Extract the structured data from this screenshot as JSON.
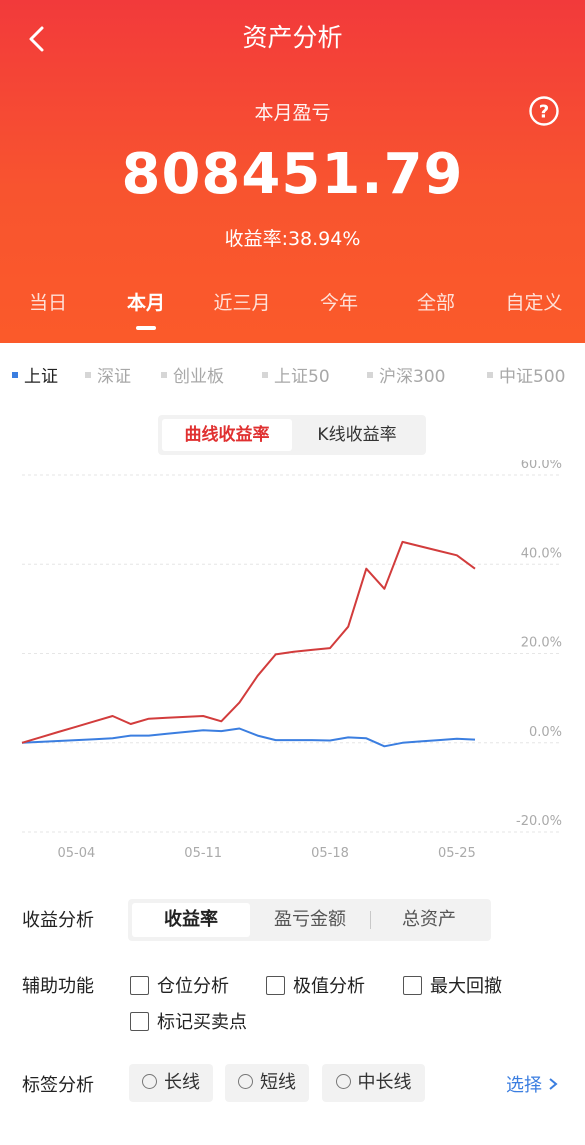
{
  "header": {
    "title": "资产分析",
    "month_label": "本月盈亏",
    "profit_value": "808451.79",
    "rate_label": "收益率:38.94%",
    "tabs": [
      "当日",
      "本月",
      "近三月",
      "今年",
      "全部",
      "自定义"
    ],
    "active_tab": "本月"
  },
  "indices": [
    "上证",
    "深证",
    "创业板",
    "上证50",
    "沪深300",
    "中证500"
  ],
  "chart_toggle": {
    "curve": "曲线收益率",
    "kline": "K线收益率"
  },
  "chart_data": {
    "type": "line",
    "x": [
      "05-01",
      "05-02",
      "05-03",
      "05-04",
      "05-05",
      "05-06",
      "05-07",
      "05-08",
      "05-09",
      "05-10",
      "05-11",
      "05-12",
      "05-13",
      "05-14",
      "05-15",
      "05-16",
      "05-17",
      "05-18",
      "05-19",
      "05-20",
      "05-21",
      "05-22",
      "05-23",
      "05-24",
      "05-25",
      "05-26"
    ],
    "x_ticks": [
      "05-04",
      "05-11",
      "05-18",
      "05-25"
    ],
    "y_ticks": [
      "60.0%",
      "40.0%",
      "20.0%",
      "0.0%",
      "-20.0%"
    ],
    "ylim": [
      -20,
      60
    ],
    "grid": true,
    "series": [
      {
        "color": "#d23c3c",
        "values": [
          0,
          1.2,
          2.4,
          3.6,
          4.8,
          6.0,
          4.2,
          5.4,
          5.6,
          5.8,
          6.0,
          4.8,
          9.0,
          15.0,
          19.8,
          20.4,
          20.8,
          21.2,
          26.0,
          39.0,
          34.5,
          45.0,
          44.0,
          43.0,
          42.0,
          39.0
        ]
      },
      {
        "color": "#3b7ee0",
        "values": [
          0,
          0.2,
          0.4,
          0.6,
          0.8,
          1.0,
          1.6,
          1.6,
          2.0,
          2.4,
          2.8,
          2.6,
          3.2,
          1.6,
          0.6,
          0.6,
          0.6,
          0.5,
          1.2,
          1.0,
          -0.8,
          0.0,
          0.3,
          0.6,
          0.9,
          0.7
        ]
      }
    ]
  },
  "analysis": {
    "label": "收益分析",
    "options": [
      "收益率",
      "盈亏金额",
      "总资产"
    ]
  },
  "aux": {
    "label": "辅助功能",
    "options": [
      "仓位分析",
      "极值分析",
      "最大回撤",
      "标记买卖点"
    ]
  },
  "tags": {
    "label": "标签分析",
    "options": [
      "长线",
      "短线",
      "中长线"
    ],
    "select": "选择"
  },
  "icons": {
    "back": "chevron-left-icon",
    "help": "question-circle-icon"
  },
  "colors": {
    "header": "#f23a3b",
    "accent": "#e03131",
    "link": "#3b7ee0"
  }
}
